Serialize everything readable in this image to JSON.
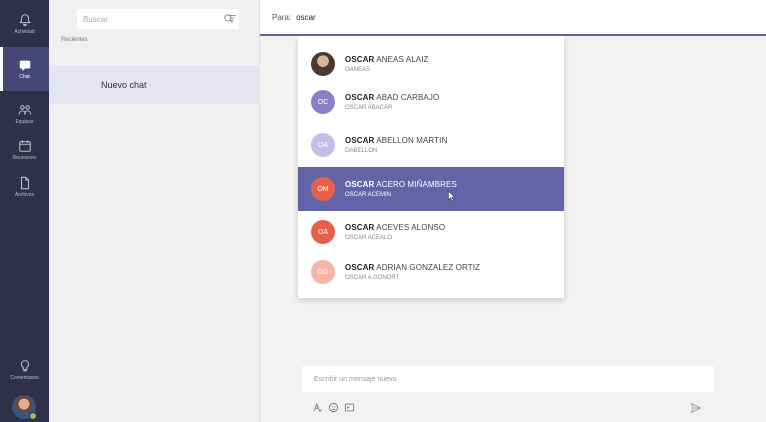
{
  "rail": {
    "items": [
      {
        "label": "Actividad",
        "icon": "bell-icon",
        "active": false
      },
      {
        "label": "Chat",
        "icon": "chat-icon",
        "active": true
      },
      {
        "label": "Equipos",
        "icon": "teams-icon",
        "active": false
      },
      {
        "label": "Reuniones",
        "icon": "calendar-icon",
        "active": false
      },
      {
        "label": "Archivos",
        "icon": "files-icon",
        "active": false
      }
    ],
    "bottom_label": "Comentarios"
  },
  "panel": {
    "search_placeholder": "Buscar",
    "recent_label": "Recientes",
    "chat_item": "Nuevo chat"
  },
  "header": {
    "to_label": "Para:",
    "to_value": "oscar"
  },
  "suggestions": [
    {
      "highlight": "OSCAR",
      "rest": " ANEAS ALAIZ",
      "sub": "OANEAS",
      "initials": "",
      "color": "#5b4636",
      "photo": true,
      "active": false
    },
    {
      "highlight": "OSCAR",
      "rest": " ABAD CARBAJO",
      "sub": "OSCAR ABACAR",
      "initials": "OC",
      "color": "#8c7fc7",
      "photo": false,
      "active": false
    },
    {
      "highlight": "OSCAR",
      "rest": " ABELLON MARTIN",
      "sub": "OABELLON",
      "initials": "OA",
      "color": "#c3bfe6",
      "photo": false,
      "active": false
    },
    {
      "highlight": "OSCAR",
      "rest": " ACERO MIÑAMBRES",
      "sub": "OSCAR ACEMIN",
      "initials": "OM",
      "color": "#e8604c",
      "photo": false,
      "active": true
    },
    {
      "highlight": "OSCAR",
      "rest": " ACEVES ALONSO",
      "sub": "OSCAR ACEALO",
      "initials": "OA",
      "color": "#e8604c",
      "photo": false,
      "active": false
    },
    {
      "highlight": "OSCAR",
      "rest": " ADRIAN GONZALEZ ORTIZ",
      "sub": "OSCAR A GONORT",
      "initials": "OG",
      "color": "#f4b4a8",
      "photo": false,
      "active": false
    }
  ],
  "compose": {
    "placeholder": "Escribir un mensaje nuevo"
  },
  "colors": {
    "brand": "#6264a7",
    "rail": "#2f3149"
  }
}
